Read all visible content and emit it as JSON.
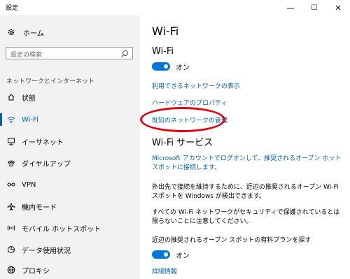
{
  "window": {
    "title": "設定",
    "controls": [
      "—",
      "☐",
      "✕"
    ]
  },
  "sidebar": {
    "home_label": "ホーム",
    "search_placeholder": "設定の検索",
    "section_label": "ネットワークとインターネット",
    "items": [
      {
        "label": "状態",
        "icon": "home-status-icon"
      },
      {
        "label": "Wi-Fi",
        "icon": "wifi-icon",
        "active": true
      },
      {
        "label": "イーサネット",
        "icon": "ethernet-icon"
      },
      {
        "label": "ダイヤルアップ",
        "icon": "dialup-icon"
      },
      {
        "label": "VPN",
        "icon": "vpn-icon"
      },
      {
        "label": "機内モード",
        "icon": "airplane-icon"
      },
      {
        "label": "モバイル ホットスポット",
        "icon": "hotspot-icon"
      },
      {
        "label": "データ使用状況",
        "icon": "data-usage-icon"
      },
      {
        "label": "プロキシ",
        "icon": "globe-icon"
      }
    ]
  },
  "main": {
    "title": "Wi-Fi",
    "wifi_heading": "Wi-Fi",
    "wifi_toggle_label": "オン",
    "links": {
      "available_networks": "利用できるネットワークの表示",
      "hardware_properties": "ハードウェアのプロパティ",
      "manage_known_networks": "既知のネットワークの管理"
    },
    "services_heading": "Wi-Fi サービス",
    "ms_account_link": "Microsoft アカウントでログオンして、推奨されるオープン ホットスポットに接続します。",
    "desc1": "外出先で接続を維持するために、近辺の推奨されるオープン Wi-Fi スポットを Windows が検出できます。",
    "desc2": "すべての Wi-Fi ネットワークがセキュリティで保護されているとは限らないことに注意してください。",
    "paid_plans_label": "近辺の推奨されるオープン スポットの有料プランを探す",
    "paid_toggle_label": "オン",
    "details_link": "詳細情報"
  },
  "colors": {
    "accent": "#0078d7",
    "link": "#0063b1",
    "highlight_oval": "#e8000f"
  }
}
